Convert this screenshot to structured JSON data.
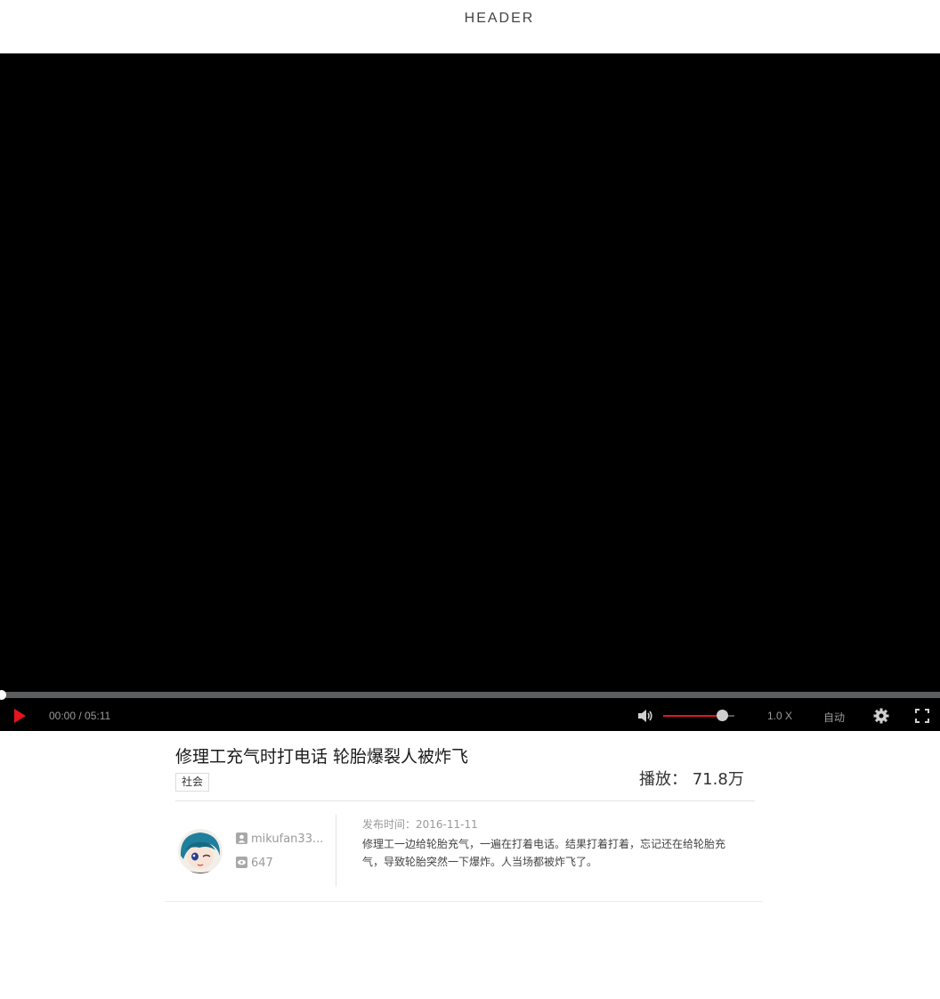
{
  "header": {
    "title": "HEADER"
  },
  "player": {
    "progress_fraction": 0,
    "time_display": "00:00 / 05:11",
    "volume_fraction": 0.82,
    "speed_label": "1.0 X",
    "quality_label": "自动",
    "accent_color": "#e5141d"
  },
  "video": {
    "title": "修理工充气时打电话 轮胎爆裂人被炸飞",
    "tag": "社会",
    "plays_label": "播放：",
    "plays_value": "71.8万",
    "author": "mikufan33...",
    "author_views": "647",
    "publish_label": "发布时间：",
    "publish_date": "2016-11-11",
    "description": "修理工一边给轮胎充气，一遍在打着电话。结果打着打着，忘记还在给轮胎充气，导致轮胎突然一下爆炸。人当场都被炸飞了。"
  },
  "icons": {
    "play": "play-icon",
    "volume": "volume-icon",
    "settings": "gear-icon",
    "fullscreen": "fullscreen-icon",
    "user": "user-icon",
    "eye": "eye-icon"
  }
}
